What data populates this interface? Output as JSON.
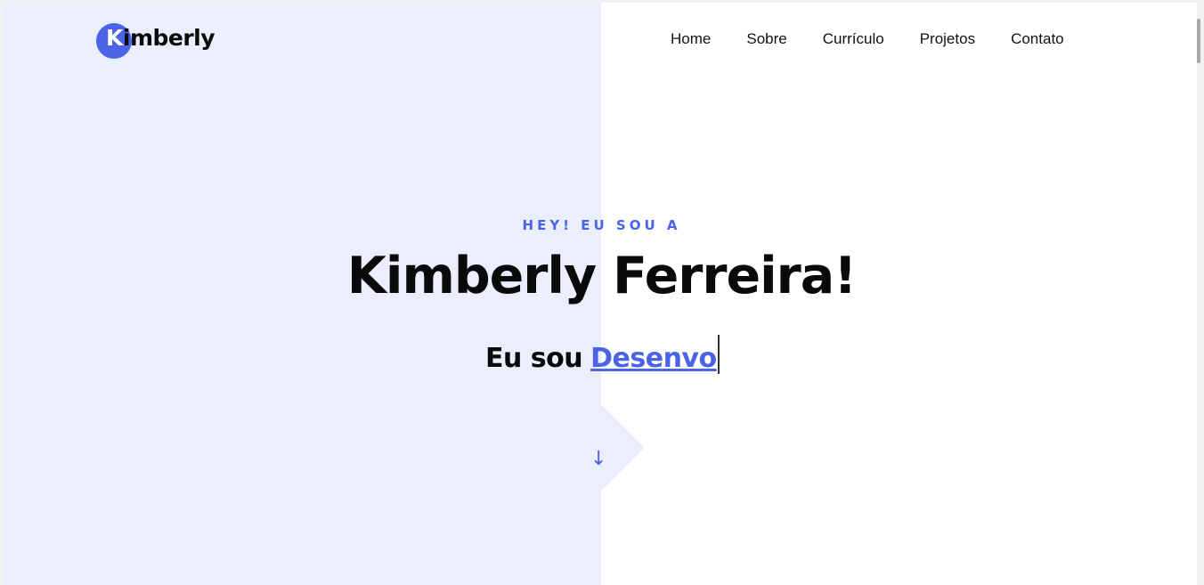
{
  "logo": {
    "initial": "K",
    "rest": "imberly"
  },
  "nav": {
    "items": [
      "Home",
      "Sobre",
      "Currículo",
      "Projetos",
      "Contato"
    ]
  },
  "hero": {
    "eyebrow": "HEY! EU SOU A",
    "title": "Kimberly Ferreira!",
    "subtitle_prefix": "Eu sou",
    "typed_text": "Desenvo"
  },
  "scroll_icon": "arrow-down-icon",
  "colors": {
    "accent": "#4a63e7",
    "left_panel": "#eaeefd",
    "text": "#0a0a0a"
  }
}
